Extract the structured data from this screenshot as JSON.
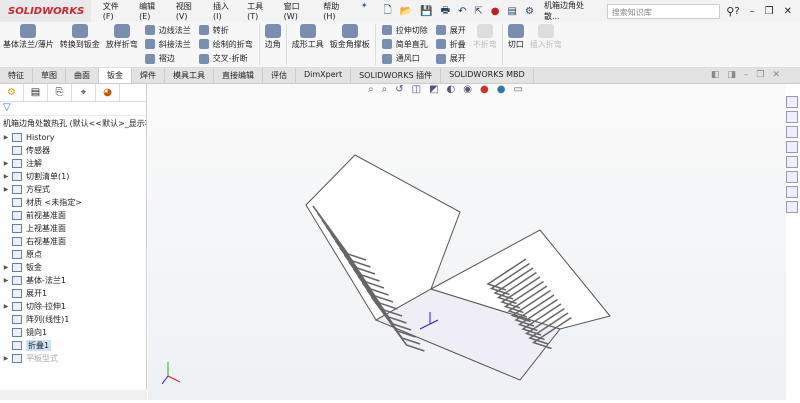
{
  "app": {
    "logo": "SOLIDWORKS",
    "document_title": "机箱边角处散...",
    "search_placeholder": "搜索知识库"
  },
  "menu": [
    "文件(F)",
    "编辑(E)",
    "视图(V)",
    "插入(I)",
    "工具(T)",
    "窗口(W)",
    "帮助(H)"
  ],
  "ribbon": {
    "big1": [
      "基体法兰/薄片",
      "转换到钣金",
      "放样折弯"
    ],
    "col1": [
      "边线法兰",
      "斜接法兰",
      "褶边"
    ],
    "col2": [
      "转折",
      "绘制的折弯",
      "交叉-折断"
    ],
    "corner": "边角",
    "big2": [
      "成形工具",
      "钣金角撑板"
    ],
    "col3": [
      "拉伸切除",
      "简单直孔",
      "通风口"
    ],
    "col4": [
      "展开",
      "折叠",
      "展开"
    ],
    "big3": [
      "不折弯",
      "切口",
      "插入折弯"
    ]
  },
  "tabs": [
    "特征",
    "草图",
    "曲面",
    "钣金",
    "焊件",
    "模具工具",
    "直接编辑",
    "评估",
    "DimXpert",
    "SOLIDWORKS 插件",
    "SOLIDWORKS MBD"
  ],
  "active_tab": "钣金",
  "tree": {
    "root": "机箱边角处散热孔 (默认<<默认>_显示状",
    "items": [
      {
        "label": "History",
        "arrow": true
      },
      {
        "label": "传感器",
        "arrow": false
      },
      {
        "label": "注解",
        "arrow": true
      },
      {
        "label": "切割清单(1)",
        "arrow": true
      },
      {
        "label": "方程式",
        "arrow": true
      },
      {
        "label": "材质 <未指定>",
        "arrow": false
      },
      {
        "label": "前视基准面",
        "arrow": false
      },
      {
        "label": "上视基准面",
        "arrow": false
      },
      {
        "label": "右视基准面",
        "arrow": false
      },
      {
        "label": "原点",
        "arrow": false
      },
      {
        "label": "钣金",
        "arrow": true
      },
      {
        "label": "基体-法兰1",
        "arrow": true
      },
      {
        "label": "展开1",
        "arrow": false
      },
      {
        "label": "切除-拉伸1",
        "arrow": true
      },
      {
        "label": "阵列(线性)1",
        "arrow": false
      },
      {
        "label": "镜向1",
        "arrow": false
      },
      {
        "label": "折叠1",
        "arrow": false,
        "selected": true
      },
      {
        "label": "平板型式",
        "arrow": true,
        "disabled": true
      }
    ]
  }
}
